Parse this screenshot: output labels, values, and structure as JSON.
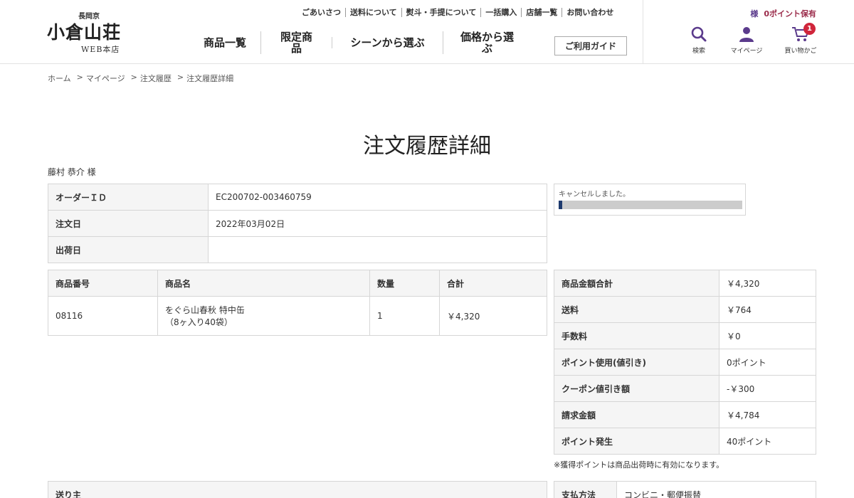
{
  "logo": {
    "top": "長岡京",
    "main": "小倉山荘",
    "sub": "WEB本店"
  },
  "utility_nav": [
    "ごあいさつ",
    "送料について",
    "熨斗・手提について",
    "一括購入",
    "店舗一覧",
    "お問い合わせ"
  ],
  "main_nav": [
    {
      "label": "商品一覧"
    },
    {
      "label": "限定商品"
    },
    {
      "label": "シーンから選ぶ"
    },
    {
      "label": "価格から選ぶ"
    }
  ],
  "guide_button": "ご利用ガイド",
  "user": {
    "sama": "様",
    "points": "0ポイント保有"
  },
  "icons": {
    "search": {
      "label": "検索",
      "icon": "search-icon"
    },
    "mypage": {
      "label": "マイページ",
      "icon": "user-icon"
    },
    "cart": {
      "label": "買い物かご",
      "icon": "cart-icon",
      "count": "1"
    }
  },
  "breadcrumb": [
    "ホーム",
    "マイページ",
    "注文履歴",
    "注文履歴詳細"
  ],
  "breadcrumb_sep": ">",
  "title": "注文履歴詳細",
  "customer_name": "藤村 恭介 様",
  "order_info": [
    {
      "label": "オーダーＩＤ",
      "value": "EC200702-003460759"
    },
    {
      "label": "注文日",
      "value": "2022年03月02日"
    },
    {
      "label": "出荷日",
      "value": ""
    }
  ],
  "status": {
    "text": "キャンセルしました。",
    "progress": 0.02
  },
  "items": {
    "headers": [
      "商品番号",
      "商品名",
      "数量",
      "合計"
    ],
    "rows": [
      {
        "code": "08116",
        "name_line1": "をぐら山春秋 特中缶",
        "name_line2": "（8ヶ入り40袋）",
        "qty": "1",
        "total": "￥4,320"
      }
    ]
  },
  "totals": [
    {
      "label": "商品金額合計",
      "value": "￥4,320"
    },
    {
      "label": "送料",
      "value": "￥764"
    },
    {
      "label": "手数料",
      "value": "￥0"
    },
    {
      "label": "ポイント使用(値引き)",
      "value": "0ポイント"
    },
    {
      "label": "クーポン値引き額",
      "value": "-￥300"
    },
    {
      "label": "請求金額",
      "value": "￥4,784"
    },
    {
      "label": "ポイント発生",
      "value": "40ポイント"
    }
  ],
  "note": "※獲得ポイントは商品出荷時に有効になります。",
  "sender": {
    "label": "送り主"
  },
  "payment": {
    "label": "支払方法",
    "value": "コンビニ・郵便振替"
  },
  "colors": {
    "accent": "#5b3b8c",
    "points": "#9b2c4b",
    "badge": "#d0253b",
    "progress": "#1e3a6e"
  }
}
